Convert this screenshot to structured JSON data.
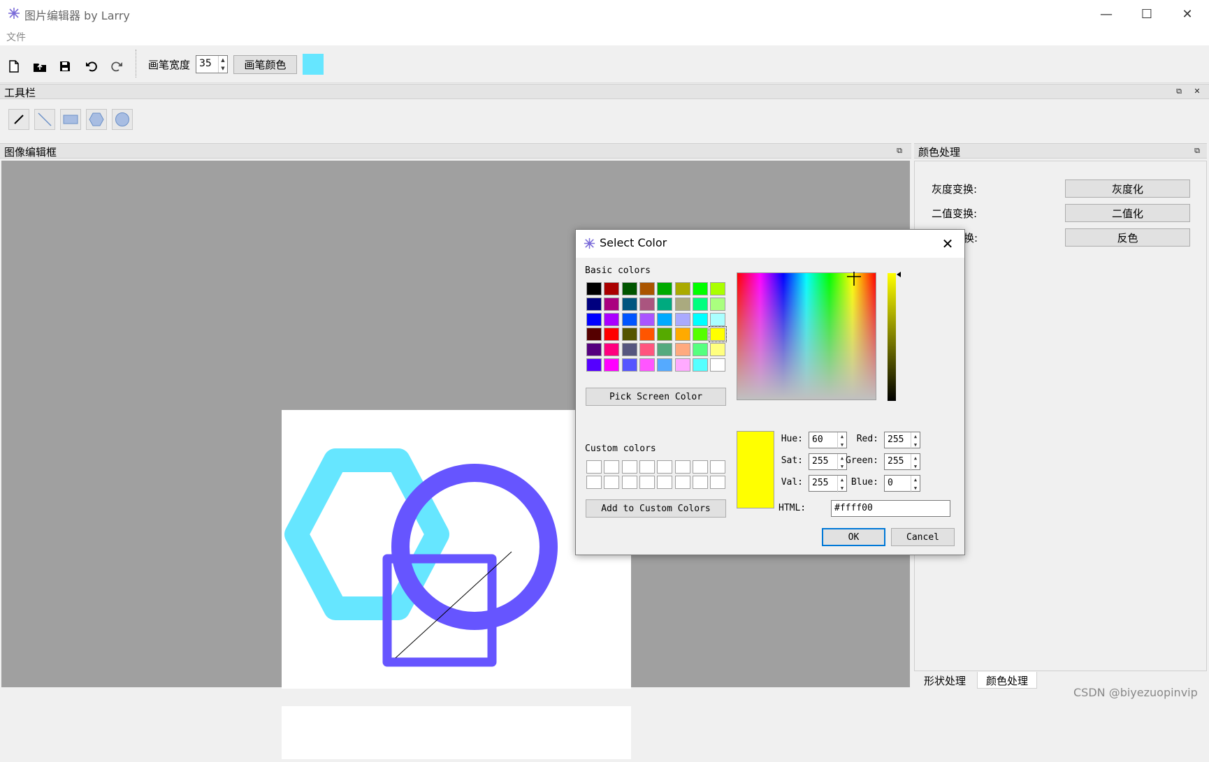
{
  "window": {
    "title": "图片编辑器 by Larry",
    "menu_file": "文件",
    "minimize": "—",
    "maximize": "☐",
    "close": "✕"
  },
  "toolbar": {
    "pen_width_label": "画笔宽度",
    "pen_width_value": "35",
    "pen_color_label": "画笔颜色",
    "pen_color": "#66e6ff"
  },
  "docks": {
    "tools_title": "工具栏",
    "editor_title": "图像编辑框",
    "color_title": "颜色处理"
  },
  "color_panel": {
    "gray_label": "灰度变换:",
    "gray_btn": "灰度化",
    "binary_label": "二值变换:",
    "binary_btn": "二值化",
    "invert_label": "换:",
    "invert_btn": "反色"
  },
  "tabs": {
    "shape": "形状处理",
    "color": "颜色处理"
  },
  "watermark": "CSDN @biyezuopinvip",
  "canvas_shapes": {
    "hexagon_color": "#66e6ff",
    "circle_color": "#6655ff",
    "rect_color": "#6655ff",
    "line_color": "#000000"
  },
  "dialog": {
    "title": "Select Color",
    "basic_colors_label": "Basic colors",
    "pick_screen": "Pick Screen Color",
    "custom_colors_label": "Custom colors",
    "add_custom": "Add to Custom Colors",
    "hue_label": "Hue:",
    "hue": "60",
    "sat_label": "Sat:",
    "sat": "255",
    "val_label": "Val:",
    "val": "255",
    "red_label": "Red:",
    "red": "255",
    "green_label": "Green:",
    "green": "255",
    "blue_label": "Blue:",
    "blue": "0",
    "html_label": "HTML:",
    "html": "#ffff00",
    "ok": "OK",
    "cancel": "Cancel",
    "current_color": "#ffff00",
    "selected_basic_index": 31,
    "basic_colors": [
      "#000000",
      "#aa0000",
      "#005500",
      "#aa5500",
      "#00aa00",
      "#aaaa00",
      "#00ff00",
      "#aaff00",
      "#00007f",
      "#aa007f",
      "#00557f",
      "#aa557f",
      "#00aa7f",
      "#aaaa7f",
      "#00ff7f",
      "#aaff7f",
      "#0000ff",
      "#aa00ff",
      "#0055ff",
      "#aa55ff",
      "#00aaff",
      "#aaaaff",
      "#00ffff",
      "#aaffff",
      "#550000",
      "#ff0000",
      "#555500",
      "#ff5500",
      "#55aa00",
      "#ffaa00",
      "#55ff00",
      "#ffff00",
      "#55007f",
      "#ff007f",
      "#55557f",
      "#ff557f",
      "#55aa7f",
      "#ffaa7f",
      "#55ff7f",
      "#ffff7f",
      "#5500ff",
      "#ff00ff",
      "#5555ff",
      "#ff55ff",
      "#55aaff",
      "#ffaaff",
      "#55ffff",
      "#ffffff"
    ]
  }
}
